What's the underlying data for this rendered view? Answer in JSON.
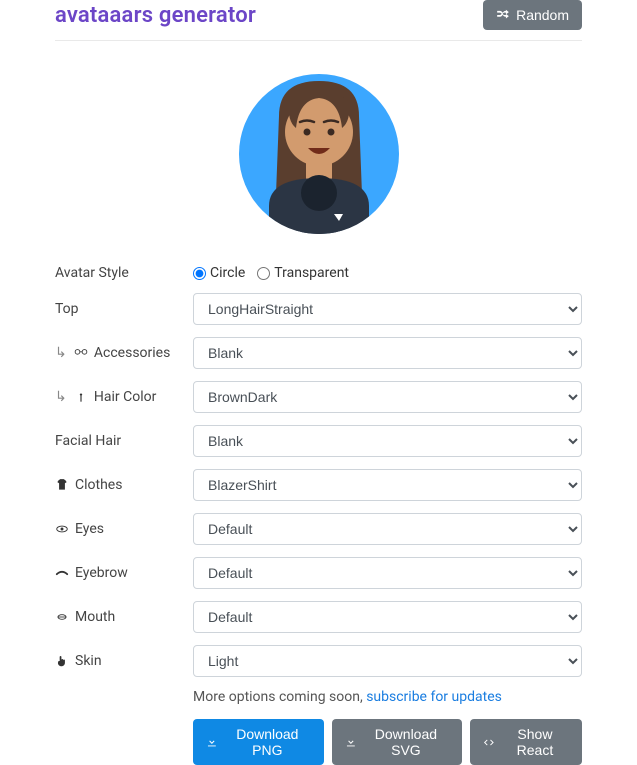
{
  "header": {
    "title": "avataaars generator",
    "random_label": "Random"
  },
  "style_row": {
    "label": "Avatar Style",
    "options": {
      "circle": "Circle",
      "transparent": "Transparent"
    },
    "selected": "circle"
  },
  "fields": [
    {
      "key": "top",
      "label": "Top",
      "value": "LongHairStraight",
      "icon": null,
      "sub": false
    },
    {
      "key": "accessories",
      "label": "Accessories",
      "value": "Blank",
      "icon": "glasses",
      "sub": true
    },
    {
      "key": "haircolor",
      "label": "Hair Color",
      "value": "BrownDark",
      "icon": "palette",
      "sub": true
    },
    {
      "key": "facialhair",
      "label": "Facial Hair",
      "value": "Blank",
      "icon": null,
      "sub": false
    },
    {
      "key": "clothes",
      "label": "Clothes",
      "value": "BlazerShirt",
      "icon": "tshirt",
      "sub": false
    },
    {
      "key": "eyes",
      "label": "Eyes",
      "value": "Default",
      "icon": "eye",
      "sub": false
    },
    {
      "key": "eyebrow",
      "label": "Eyebrow",
      "value": "Default",
      "icon": "brow",
      "sub": false
    },
    {
      "key": "mouth",
      "label": "Mouth",
      "value": "Default",
      "icon": "mouth",
      "sub": false
    },
    {
      "key": "skin",
      "label": "Skin",
      "value": "Light",
      "icon": "hand",
      "sub": false
    }
  ],
  "more_options": {
    "text": "More options coming soon, ",
    "link_text": "subscribe for updates"
  },
  "buttons": {
    "png": "Download PNG",
    "svg": "Download SVG",
    "react": "Show React"
  },
  "colors": {
    "accent_circle": "#3ba7ff",
    "skin": "#D29B6E",
    "hair": "#5A3E2E",
    "clothes": "#2b3544"
  }
}
